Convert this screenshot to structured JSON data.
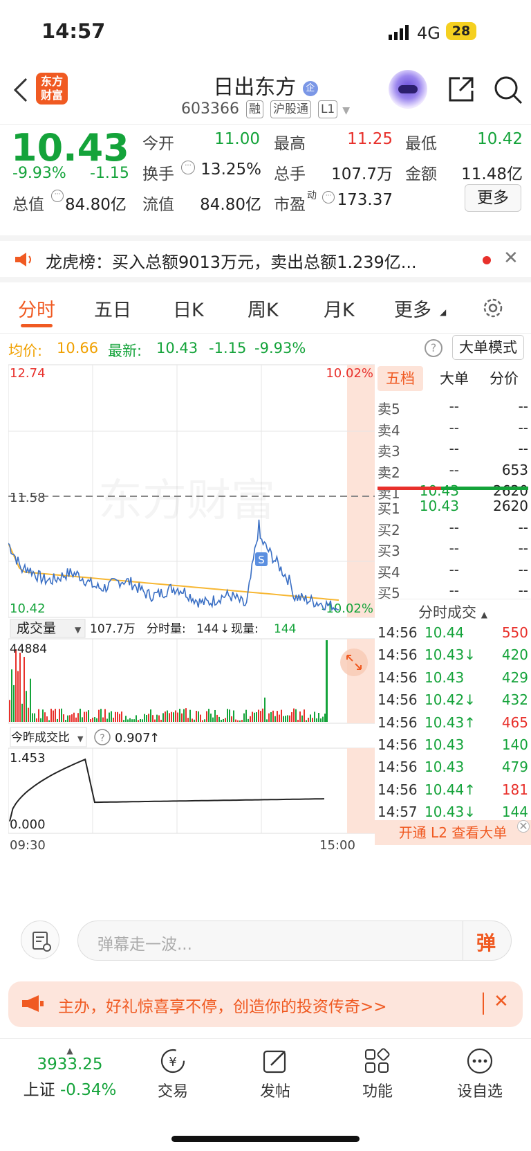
{
  "status_bar": {
    "time": "14:57",
    "network": "4G",
    "battery": "28"
  },
  "header": {
    "title": "日出东方",
    "badge": "企",
    "code": "603366",
    "tags": [
      "融",
      "沪股通",
      "L1"
    ]
  },
  "quote": {
    "price": "10.43",
    "change_pct": "-9.93%",
    "change": "-1.15",
    "open_label": "今开",
    "open": "11.00",
    "high_label": "最高",
    "high": "11.25",
    "low_label": "最低",
    "low": "10.42",
    "turnover_label": "换手",
    "turnover": "13.25%",
    "volume_label": "总手",
    "volume": "107.7万",
    "amount_label": "金额",
    "amount": "11.48亿",
    "mktcap_label": "总值",
    "mktcap": "84.80亿",
    "float_label": "流值",
    "float": "84.80亿",
    "pe_label": "市盈",
    "pe_sup": "动",
    "pe": "173.37",
    "more_button": "更多"
  },
  "banner": {
    "text": "龙虎榜：买入总额9013万元，卖出总额1.239亿..."
  },
  "tabs": [
    "分时",
    "五日",
    "日K",
    "周K",
    "月K",
    "更多"
  ],
  "info_line": {
    "avg_label": "均价:",
    "avg": "10.66",
    "latest_label": "最新:",
    "latest": "10.43",
    "change": "-1.15",
    "change_pct": "-9.93%",
    "mode_button": "大单模式"
  },
  "chart_data": {
    "type": "line",
    "title": "",
    "y_max_label": "12.74",
    "y_min_label": "10.42",
    "y_pct_max_label": "10.02%",
    "y_pct_min_label": "-10.02%",
    "prev_close_label": "11.58",
    "ylim": [
      10.42,
      12.74
    ],
    "x_start_label": "09:30",
    "x_end_label": "15:00",
    "watermark": "东方财富",
    "volume_panel": {
      "selector_label": "成交量",
      "total": "107.7万",
      "tick_label": "分时量:",
      "tick": "144",
      "now_label": "现量:",
      "now": "144",
      "max_label": "44884"
    },
    "ratio_panel": {
      "selector_label": "今昨成交比",
      "value": "0.907",
      "max_label": "1.453",
      "min_label": "0.000"
    }
  },
  "order_book": {
    "tabs": [
      "五档",
      "大单",
      "分价"
    ],
    "asks": [
      {
        "label": "卖5",
        "price": "--",
        "vol": "--"
      },
      {
        "label": "卖4",
        "price": "--",
        "vol": "--"
      },
      {
        "label": "卖3",
        "price": "--",
        "vol": "--"
      },
      {
        "label": "卖2",
        "price": "--",
        "vol": "653"
      },
      {
        "label": "卖1",
        "price": "10.43",
        "vol": "2620"
      }
    ],
    "bids": [
      {
        "label": "买1",
        "price": "10.43",
        "vol": "2620"
      },
      {
        "label": "买2",
        "price": "--",
        "vol": "--"
      },
      {
        "label": "买3",
        "price": "--",
        "vol": "--"
      },
      {
        "label": "买4",
        "price": "--",
        "vol": "--"
      },
      {
        "label": "买5",
        "price": "--",
        "vol": "--"
      }
    ],
    "ticks_header": "分时成交",
    "ticks": [
      {
        "time": "14:56",
        "price": "10.44",
        "vol": "550"
      },
      {
        "time": "14:56",
        "price": "10.43↓",
        "vol": "420"
      },
      {
        "time": "14:56",
        "price": "10.43",
        "vol": "429"
      },
      {
        "time": "14:56",
        "price": "10.42↓",
        "vol": "432"
      },
      {
        "time": "14:56",
        "price": "10.43↑",
        "vol": "465"
      },
      {
        "time": "14:56",
        "price": "10.43",
        "vol": "140"
      },
      {
        "time": "14:56",
        "price": "10.43",
        "vol": "479"
      },
      {
        "time": "14:56",
        "price": "10.44↑",
        "vol": "181"
      },
      {
        "time": "14:57",
        "price": "10.43↓",
        "vol": "144"
      }
    ],
    "l2_link": "开通 L2 查看大单"
  },
  "input_bar": {
    "placeholder": "弹幕走一波...",
    "send_label": "弹"
  },
  "promo": {
    "text": "主办，好礼惊喜享不停，创造你的投资传奇>>"
  },
  "bottom_nav": {
    "index_value": "3933.25",
    "index_name": "上证",
    "index_change": "-0.34%",
    "items": [
      "交易",
      "发帖",
      "功能",
      "设自选"
    ]
  }
}
